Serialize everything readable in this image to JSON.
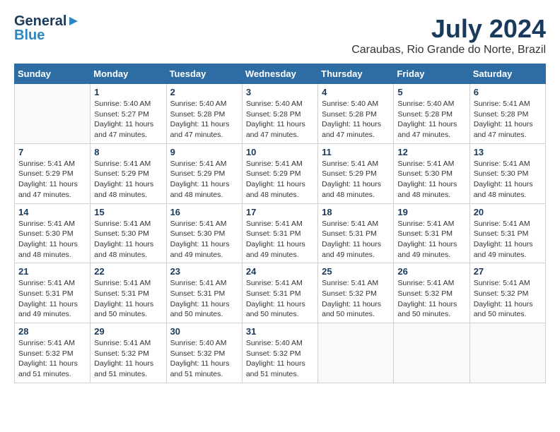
{
  "header": {
    "logo": {
      "line1": "General",
      "line2": "Blue"
    },
    "title": "July 2024",
    "subtitle": "Caraubas, Rio Grande do Norte, Brazil"
  },
  "weekdays": [
    "Sunday",
    "Monday",
    "Tuesday",
    "Wednesday",
    "Thursday",
    "Friday",
    "Saturday"
  ],
  "weeks": [
    [
      {
        "day": "",
        "info": ""
      },
      {
        "day": "1",
        "info": "Sunrise: 5:40 AM\nSunset: 5:27 PM\nDaylight: 11 hours\nand 47 minutes."
      },
      {
        "day": "2",
        "info": "Sunrise: 5:40 AM\nSunset: 5:28 PM\nDaylight: 11 hours\nand 47 minutes."
      },
      {
        "day": "3",
        "info": "Sunrise: 5:40 AM\nSunset: 5:28 PM\nDaylight: 11 hours\nand 47 minutes."
      },
      {
        "day": "4",
        "info": "Sunrise: 5:40 AM\nSunset: 5:28 PM\nDaylight: 11 hours\nand 47 minutes."
      },
      {
        "day": "5",
        "info": "Sunrise: 5:40 AM\nSunset: 5:28 PM\nDaylight: 11 hours\nand 47 minutes."
      },
      {
        "day": "6",
        "info": "Sunrise: 5:41 AM\nSunset: 5:28 PM\nDaylight: 11 hours\nand 47 minutes."
      }
    ],
    [
      {
        "day": "7",
        "info": "Sunrise: 5:41 AM\nSunset: 5:29 PM\nDaylight: 11 hours\nand 47 minutes."
      },
      {
        "day": "8",
        "info": "Sunrise: 5:41 AM\nSunset: 5:29 PM\nDaylight: 11 hours\nand 48 minutes."
      },
      {
        "day": "9",
        "info": "Sunrise: 5:41 AM\nSunset: 5:29 PM\nDaylight: 11 hours\nand 48 minutes."
      },
      {
        "day": "10",
        "info": "Sunrise: 5:41 AM\nSunset: 5:29 PM\nDaylight: 11 hours\nand 48 minutes."
      },
      {
        "day": "11",
        "info": "Sunrise: 5:41 AM\nSunset: 5:29 PM\nDaylight: 11 hours\nand 48 minutes."
      },
      {
        "day": "12",
        "info": "Sunrise: 5:41 AM\nSunset: 5:30 PM\nDaylight: 11 hours\nand 48 minutes."
      },
      {
        "day": "13",
        "info": "Sunrise: 5:41 AM\nSunset: 5:30 PM\nDaylight: 11 hours\nand 48 minutes."
      }
    ],
    [
      {
        "day": "14",
        "info": "Sunrise: 5:41 AM\nSunset: 5:30 PM\nDaylight: 11 hours\nand 48 minutes."
      },
      {
        "day": "15",
        "info": "Sunrise: 5:41 AM\nSunset: 5:30 PM\nDaylight: 11 hours\nand 48 minutes."
      },
      {
        "day": "16",
        "info": "Sunrise: 5:41 AM\nSunset: 5:30 PM\nDaylight: 11 hours\nand 49 minutes."
      },
      {
        "day": "17",
        "info": "Sunrise: 5:41 AM\nSunset: 5:31 PM\nDaylight: 11 hours\nand 49 minutes."
      },
      {
        "day": "18",
        "info": "Sunrise: 5:41 AM\nSunset: 5:31 PM\nDaylight: 11 hours\nand 49 minutes."
      },
      {
        "day": "19",
        "info": "Sunrise: 5:41 AM\nSunset: 5:31 PM\nDaylight: 11 hours\nand 49 minutes."
      },
      {
        "day": "20",
        "info": "Sunrise: 5:41 AM\nSunset: 5:31 PM\nDaylight: 11 hours\nand 49 minutes."
      }
    ],
    [
      {
        "day": "21",
        "info": "Sunrise: 5:41 AM\nSunset: 5:31 PM\nDaylight: 11 hours\nand 49 minutes."
      },
      {
        "day": "22",
        "info": "Sunrise: 5:41 AM\nSunset: 5:31 PM\nDaylight: 11 hours\nand 50 minutes."
      },
      {
        "day": "23",
        "info": "Sunrise: 5:41 AM\nSunset: 5:31 PM\nDaylight: 11 hours\nand 50 minutes."
      },
      {
        "day": "24",
        "info": "Sunrise: 5:41 AM\nSunset: 5:31 PM\nDaylight: 11 hours\nand 50 minutes."
      },
      {
        "day": "25",
        "info": "Sunrise: 5:41 AM\nSunset: 5:32 PM\nDaylight: 11 hours\nand 50 minutes."
      },
      {
        "day": "26",
        "info": "Sunrise: 5:41 AM\nSunset: 5:32 PM\nDaylight: 11 hours\nand 50 minutes."
      },
      {
        "day": "27",
        "info": "Sunrise: 5:41 AM\nSunset: 5:32 PM\nDaylight: 11 hours\nand 50 minutes."
      }
    ],
    [
      {
        "day": "28",
        "info": "Sunrise: 5:41 AM\nSunset: 5:32 PM\nDaylight: 11 hours\nand 51 minutes."
      },
      {
        "day": "29",
        "info": "Sunrise: 5:41 AM\nSunset: 5:32 PM\nDaylight: 11 hours\nand 51 minutes."
      },
      {
        "day": "30",
        "info": "Sunrise: 5:40 AM\nSunset: 5:32 PM\nDaylight: 11 hours\nand 51 minutes."
      },
      {
        "day": "31",
        "info": "Sunrise: 5:40 AM\nSunset: 5:32 PM\nDaylight: 11 hours\nand 51 minutes."
      },
      {
        "day": "",
        "info": ""
      },
      {
        "day": "",
        "info": ""
      },
      {
        "day": "",
        "info": ""
      }
    ]
  ]
}
